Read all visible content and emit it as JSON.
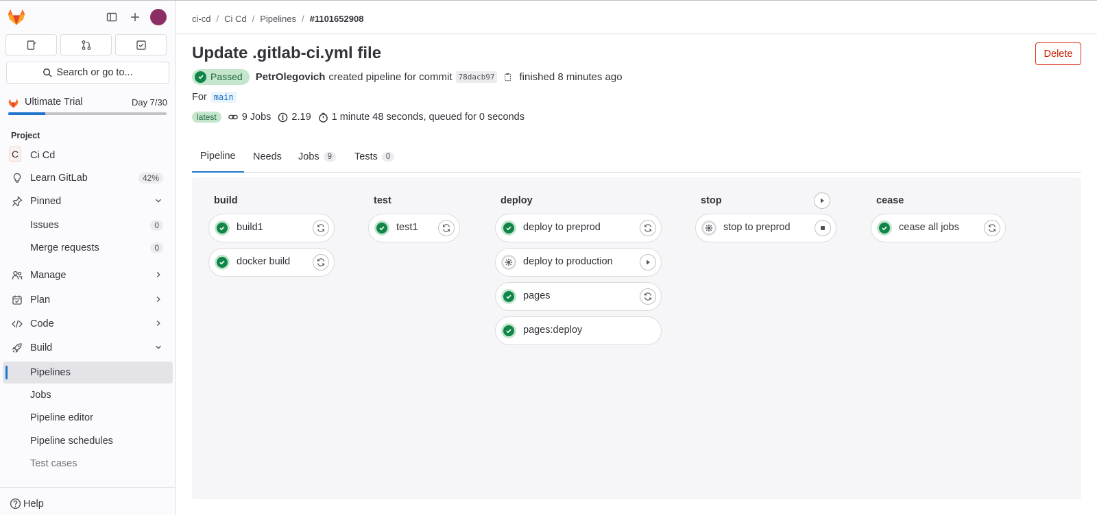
{
  "sidebar": {
    "search_label": "Search or go to...",
    "trial": {
      "name": "Ultimate Trial",
      "day": "Day 7/30",
      "progress": 0.233
    },
    "section_label": "Project",
    "project": {
      "avatar_letter": "C",
      "name": "Ci Cd"
    },
    "learn": {
      "label": "Learn GitLab",
      "badge": "42%"
    },
    "pinned": {
      "label": "Pinned"
    },
    "pinned_items": [
      {
        "label": "Issues",
        "count": "0"
      },
      {
        "label": "Merge requests",
        "count": "0"
      }
    ],
    "groups": [
      {
        "label": "Manage",
        "icon": "users-icon"
      },
      {
        "label": "Plan",
        "icon": "calendar-icon"
      },
      {
        "label": "Code",
        "icon": "code-icon"
      },
      {
        "label": "Build",
        "icon": "rocket-icon"
      }
    ],
    "build_items": [
      {
        "label": "Pipelines",
        "active": true
      },
      {
        "label": "Jobs"
      },
      {
        "label": "Pipeline editor"
      },
      {
        "label": "Pipeline schedules"
      },
      {
        "label": "Test cases"
      }
    ],
    "help": "Help"
  },
  "breadcrumb": [
    "ci-cd",
    "Ci Cd",
    "Pipelines",
    "#1101652908"
  ],
  "page": {
    "title": "Update .gitlab-ci.yml file",
    "delete_label": "Delete",
    "status": "Passed",
    "author": "PetrOlegovich",
    "created_text": "created pipeline for commit",
    "commit_sha": "78dacb97",
    "finished_text": "finished 8 minutes ago",
    "for_label": "For",
    "branch": "main",
    "latest_label": "latest",
    "jobs_count": "9 Jobs",
    "compute": "2.19",
    "duration": "1 minute 48 seconds, queued for 0 seconds"
  },
  "tabs": [
    {
      "label": "Pipeline",
      "active": true
    },
    {
      "label": "Needs"
    },
    {
      "label": "Jobs",
      "count": "9"
    },
    {
      "label": "Tests",
      "count": "0"
    }
  ],
  "stages": [
    {
      "name": "build",
      "jobs": [
        {
          "name": "build1",
          "status": "success",
          "action": "retry"
        },
        {
          "name": "docker build",
          "status": "success",
          "action": "retry"
        }
      ]
    },
    {
      "name": "test",
      "jobs": [
        {
          "name": "test1",
          "status": "success",
          "action": "retry"
        }
      ]
    },
    {
      "name": "deploy",
      "jobs": [
        {
          "name": "deploy to preprod",
          "status": "success",
          "action": "retry"
        },
        {
          "name": "deploy to production",
          "status": "manual",
          "action": "play"
        },
        {
          "name": "pages",
          "status": "success",
          "action": "retry"
        },
        {
          "name": "pages:deploy",
          "status": "success",
          "action": "none"
        }
      ]
    },
    {
      "name": "stop",
      "stage_action": "play",
      "jobs": [
        {
          "name": "stop to preprod",
          "status": "manual",
          "action": "stop"
        }
      ]
    },
    {
      "name": "cease",
      "jobs": [
        {
          "name": "cease all jobs",
          "status": "success",
          "action": "retry"
        }
      ]
    }
  ],
  "colors": {
    "accent": "#1f75cb",
    "success": "#108548",
    "danger": "#dd2b0e"
  }
}
